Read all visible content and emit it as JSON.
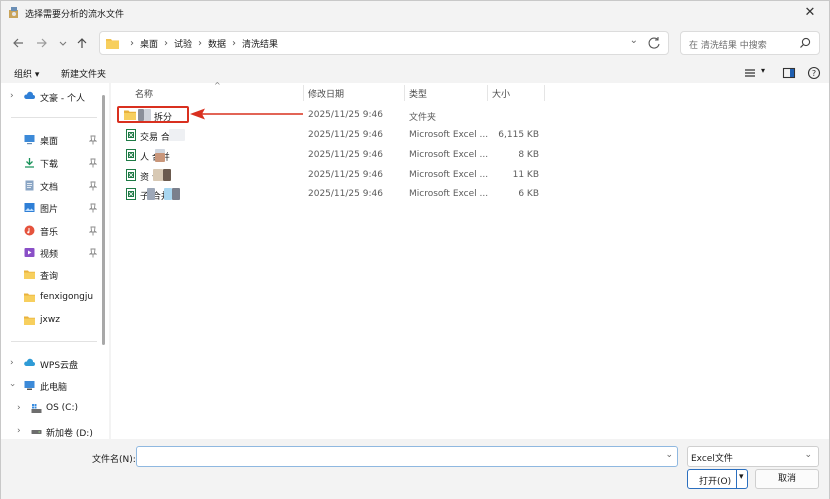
{
  "window": {
    "title": "选择需要分析的流水文件"
  },
  "address": {
    "crumbs": [
      "桌面",
      "试验",
      "数据",
      "清洗结果"
    ]
  },
  "search": {
    "placeholder": "在 清洗结果 中搜索"
  },
  "commands": {
    "organize": "组织 ▾",
    "new_folder": "新建文件夹"
  },
  "sidebar": {
    "items": [
      {
        "label": "文豪 - 个人",
        "icon": "cloud-icon"
      },
      {
        "label": "桌面",
        "icon": "desktop-icon",
        "pinned": true
      },
      {
        "label": "下载",
        "icon": "download-icon",
        "pinned": true
      },
      {
        "label": "文档",
        "icon": "document-icon",
        "pinned": true
      },
      {
        "label": "图片",
        "icon": "picture-icon",
        "pinned": true
      },
      {
        "label": "音乐",
        "icon": "music-icon",
        "pinned": true
      },
      {
        "label": "视频",
        "icon": "video-icon",
        "pinned": true
      },
      {
        "label": "查询",
        "icon": "folder-icon"
      },
      {
        "label": "fenxigongju",
        "icon": "folder-icon"
      },
      {
        "label": "jxwz",
        "icon": "folder-icon"
      },
      {
        "label": "WPS云盘",
        "icon": "cloud-icon"
      },
      {
        "label": "此电脑",
        "icon": "computer-icon"
      },
      {
        "label": "OS (C:)",
        "icon": "drive-icon"
      },
      {
        "label": "新加卷 (D:)",
        "icon": "drive-icon"
      }
    ]
  },
  "columns": {
    "name": "名称",
    "date": "修改日期",
    "type": "类型",
    "size": "大小"
  },
  "files": [
    {
      "name": "拆分",
      "date": "2025/11/25 9:46",
      "type": "文件夹",
      "size": ""
    },
    {
      "name": "交易      合并",
      "date": "2025/11/25 9:46",
      "type": "Microsoft Excel ...",
      "size": "6,115 KB"
    },
    {
      "name": "人      合并",
      "date": "2025/11/25 9:46",
      "type": "Microsoft Excel ...",
      "size": "8 KB"
    },
    {
      "name": "资      合并",
      "date": "2025/11/25 9:46",
      "type": "Microsoft Excel ...",
      "size": "11 KB"
    },
    {
      "name": "子      合并",
      "date": "2025/11/25 9:46",
      "type": "Microsoft Excel ...",
      "size": "6 KB"
    }
  ],
  "bottom": {
    "filename_label": "文件名(N):",
    "filename_value": "",
    "filetype": "Excel文件",
    "open_label": "打开(O)",
    "cancel_label": "取消"
  },
  "colors": {
    "accent": "#2b6fbf",
    "highlight": "#d9301f",
    "excel": "#1d7a45",
    "folder": "#f3c24d"
  }
}
